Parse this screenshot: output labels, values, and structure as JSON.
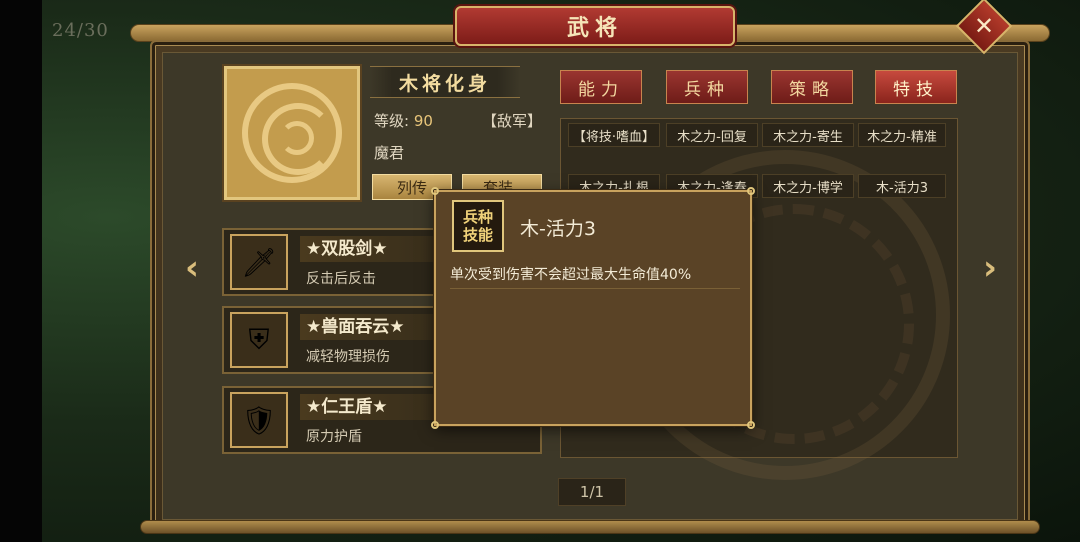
{
  "counter": "24/30",
  "window_title": "武将",
  "close_label": "✕",
  "general": {
    "name": "木将化身",
    "level_label": "等级:",
    "level_value": "90",
    "faction": "【敌军】",
    "race": "魔君",
    "bio_button": "列传",
    "set_button": "套装"
  },
  "equipment": [
    {
      "name": "★双股剑★",
      "desc": "反击后反击",
      "icon": "sword-icon",
      "glyph": "🗡"
    },
    {
      "name": "★兽面吞云★",
      "desc": "减轻物理损伤",
      "icon": "armor-icon",
      "glyph": "⛨"
    },
    {
      "name": "★仁王盾★",
      "desc": "原力护盾",
      "icon": "shield-icon",
      "glyph": "🛡"
    }
  ],
  "tabs": [
    {
      "label": "能力",
      "active": false
    },
    {
      "label": "兵种",
      "active": false
    },
    {
      "label": "策略",
      "active": false
    },
    {
      "label": "特技",
      "active": true
    }
  ],
  "skills": [
    "【将技·嗜血】",
    "木之力-回复",
    "木之力-寄生",
    "木之力-精准",
    "木之力-扎根",
    "木之力-逢春",
    "木之力-博学",
    "木-活力3"
  ],
  "pager": "1/1",
  "tooltip": {
    "badge_line1": "兵种",
    "badge_line2": "技能",
    "title": "木-活力3",
    "description": "单次受到伤害不会超过最大生命值40%"
  },
  "colors": {
    "accent_red": "#9a3530",
    "gold": "#c9a35e"
  }
}
